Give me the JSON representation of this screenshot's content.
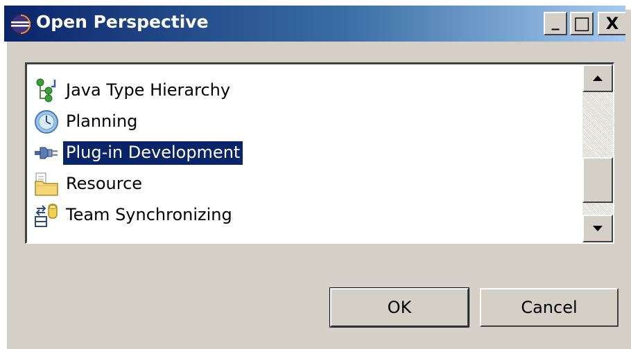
{
  "window": {
    "title": "Open Perspective",
    "title_icon": "eclipse-icon",
    "controls": {
      "minimize": "_",
      "maximize": "□",
      "close": "X"
    },
    "titlebar_colors": [
      "#0a246a",
      "#a6caf0"
    ]
  },
  "perspectives": {
    "items": [
      {
        "label": "Java Type Hierarchy",
        "icon": "hierarchy-icon",
        "selected": false
      },
      {
        "label": "Planning",
        "icon": "clock-icon",
        "selected": false
      },
      {
        "label": "Plug-in Development",
        "icon": "plug-icon",
        "selected": true
      },
      {
        "label": "Resource",
        "icon": "folder-icon",
        "selected": false
      },
      {
        "label": "Team Synchronizing",
        "icon": "synchronize-icon",
        "selected": false
      }
    ],
    "selection_color": "#0a246a"
  },
  "buttons": {
    "ok": "OK",
    "cancel": "Cancel"
  }
}
